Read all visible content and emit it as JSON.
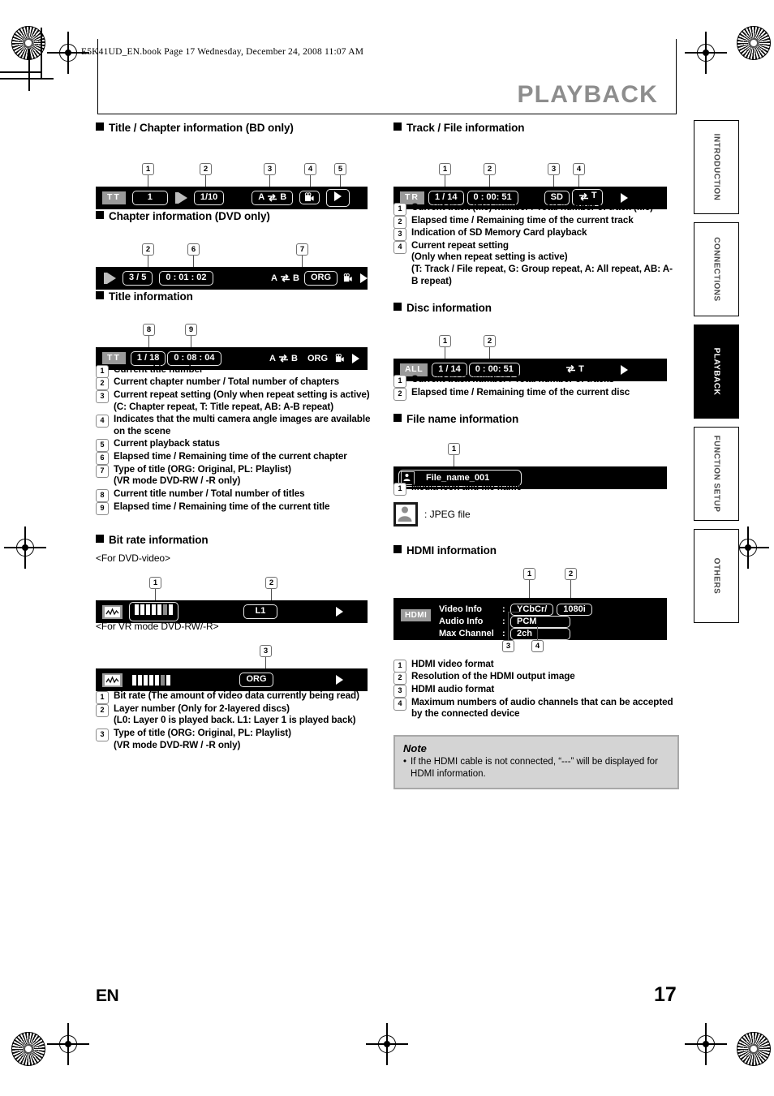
{
  "header": {
    "file_line": "E5K41UD_EN.book  Page 17  Wednesday, December 24, 2008  11:07 AM",
    "chapter_title": "PLAYBACK"
  },
  "footer": {
    "language": "EN",
    "page_number": "17"
  },
  "side_tabs": [
    {
      "label": "INTRODUCTION",
      "active": false
    },
    {
      "label": "CONNECTIONS",
      "active": false
    },
    {
      "label": "PLAYBACK",
      "active": true
    },
    {
      "label": "FUNCTION SETUP",
      "active": false
    },
    {
      "label": "OTHERS",
      "active": false
    }
  ],
  "left_column": {
    "section_title_chapter": {
      "heading": "Title / Chapter information (BD only)",
      "osd": {
        "badge": "TT",
        "title_number": "1",
        "chapter": "1/10",
        "repeat": "A  B",
        "repeat_a": "A",
        "repeat_b": "B",
        "angle_icon": "movie-camera-icon",
        "status_icon": "play-icon"
      },
      "callouts": [
        "1",
        "2",
        "3",
        "4",
        "5"
      ]
    },
    "section_chapter": {
      "heading": "Chapter information (DVD only)",
      "osd": {
        "chapter": "3 / 5",
        "time": "0 : 01 : 02",
        "repeat_a": "A",
        "repeat_b": "B",
        "org": "ORG"
      },
      "callouts": [
        "2",
        "6",
        "7"
      ]
    },
    "section_title": {
      "heading": "Title information",
      "osd": {
        "badge": "TT",
        "title": "1 / 18",
        "time": "0 : 08 : 04",
        "repeat_a": "A",
        "repeat_b": "B",
        "org": "ORG"
      },
      "callouts": [
        "8",
        "9"
      ]
    },
    "descriptions": [
      {
        "n": "1",
        "text": "Current title number"
      },
      {
        "n": "2",
        "text": "Current chapter number / Total number of chapters"
      },
      {
        "n": "3",
        "text": "Current repeat setting (Only when repeat setting is active)\n(C: Chapter repeat, T: Title repeat, AB: A-B repeat)"
      },
      {
        "n": "4",
        "text": "Indicates that the multi camera angle images are available on the scene"
      },
      {
        "n": "5",
        "text": "Current playback status"
      },
      {
        "n": "6",
        "text": "Elapsed time / Remaining time of the current chapter"
      },
      {
        "n": "7",
        "text": "Type of title (ORG: Original, PL: Playlist)\n(VR mode DVD-RW / -R only)"
      },
      {
        "n": "8",
        "text": "Current title number / Total number of titles"
      },
      {
        "n": "9",
        "text": "Elapsed time / Remaining time of the current title"
      }
    ],
    "section_bitrate": {
      "heading": "Bit rate information",
      "sub_dvd_video": "<For DVD-video>",
      "sub_vr_mode": "<For VR mode DVD-RW/-R>",
      "osd_dvd": {
        "layer": "L1",
        "meter_total": 7,
        "meter_dim_index": 5
      },
      "osd_vr": {
        "org": "ORG",
        "meter_total": 7,
        "meter_dim_index": 5
      },
      "callouts_dvd": [
        "1",
        "2"
      ],
      "callouts_vr": [
        "3"
      ],
      "descriptions": [
        {
          "n": "1",
          "text": "Bit rate (The amount of video data currently being read)"
        },
        {
          "n": "2",
          "text": "Layer number (Only for 2-layered discs)\n(L0: Layer 0 is played back. L1: Layer 1 is played back)"
        },
        {
          "n": "3",
          "text": "Type of title (ORG: Original, PL: Playlist)\n(VR mode DVD-RW / -R only)"
        }
      ]
    }
  },
  "right_column": {
    "section_track_file": {
      "heading": "Track / File information",
      "osd": {
        "badge": "TR",
        "track": "1 / 14",
        "time": "0 : 00: 51",
        "sd": "SD",
        "repeat_label": "T"
      },
      "callouts": [
        "1",
        "2",
        "3",
        "4"
      ],
      "descriptions": [
        {
          "n": "1",
          "text": "Current track (file) number / Total number of track (file)"
        },
        {
          "n": "2",
          "text": "Elapsed time / Remaining time of the current track"
        },
        {
          "n": "3",
          "text": "Indication of SD Memory Card playback"
        },
        {
          "n": "4",
          "text": "Current repeat setting\n(Only when repeat setting is active)\n(T: Track / File repeat, G: Group repeat, A: All repeat, AB: A-B repeat)"
        }
      ]
    },
    "section_disc": {
      "heading": "Disc information",
      "osd": {
        "badge": "ALL",
        "track": "1 / 14",
        "time": "0 : 00: 51",
        "repeat_label": "T"
      },
      "callouts": [
        "1",
        "2"
      ],
      "descriptions": [
        {
          "n": "1",
          "text": "Current track number / Total number of tracks"
        },
        {
          "n": "2",
          "text": "Elapsed time / Remaining time of the current disc"
        }
      ]
    },
    "section_filename": {
      "heading": "File name information",
      "osd": {
        "file_name": "File_name_001",
        "media_icon": "jpeg-person-icon"
      },
      "callouts": [
        "1"
      ],
      "descriptions": [
        {
          "n": "1",
          "text": "Media icon and file name"
        }
      ],
      "legend": ": JPEG file"
    },
    "section_hdmi": {
      "heading": "HDMI information",
      "osd": {
        "badge": "HDMI",
        "rows": [
          {
            "label": "Video Info",
            "colon": ":",
            "value": "YCbCr/",
            "value2": "1080i"
          },
          {
            "label": "Audio Info",
            "colon": ":",
            "value": "PCM"
          },
          {
            "label": "Max Channel",
            "colon": ":",
            "value": "2ch"
          }
        ]
      },
      "callouts": [
        "1",
        "2",
        "3",
        "4"
      ],
      "descriptions": [
        {
          "n": "1",
          "text": "HDMI video format"
        },
        {
          "n": "2",
          "text": "Resolution of the HDMI output image"
        },
        {
          "n": "3",
          "text": "HDMI audio format"
        },
        {
          "n": "4",
          "text": "Maximum numbers of audio channels that can be accepted by the connected device"
        }
      ]
    },
    "note": {
      "title": "Note",
      "bullet": "•",
      "text": "If the HDMI cable is not connected, “---” will be displayed for HDMI information."
    }
  }
}
